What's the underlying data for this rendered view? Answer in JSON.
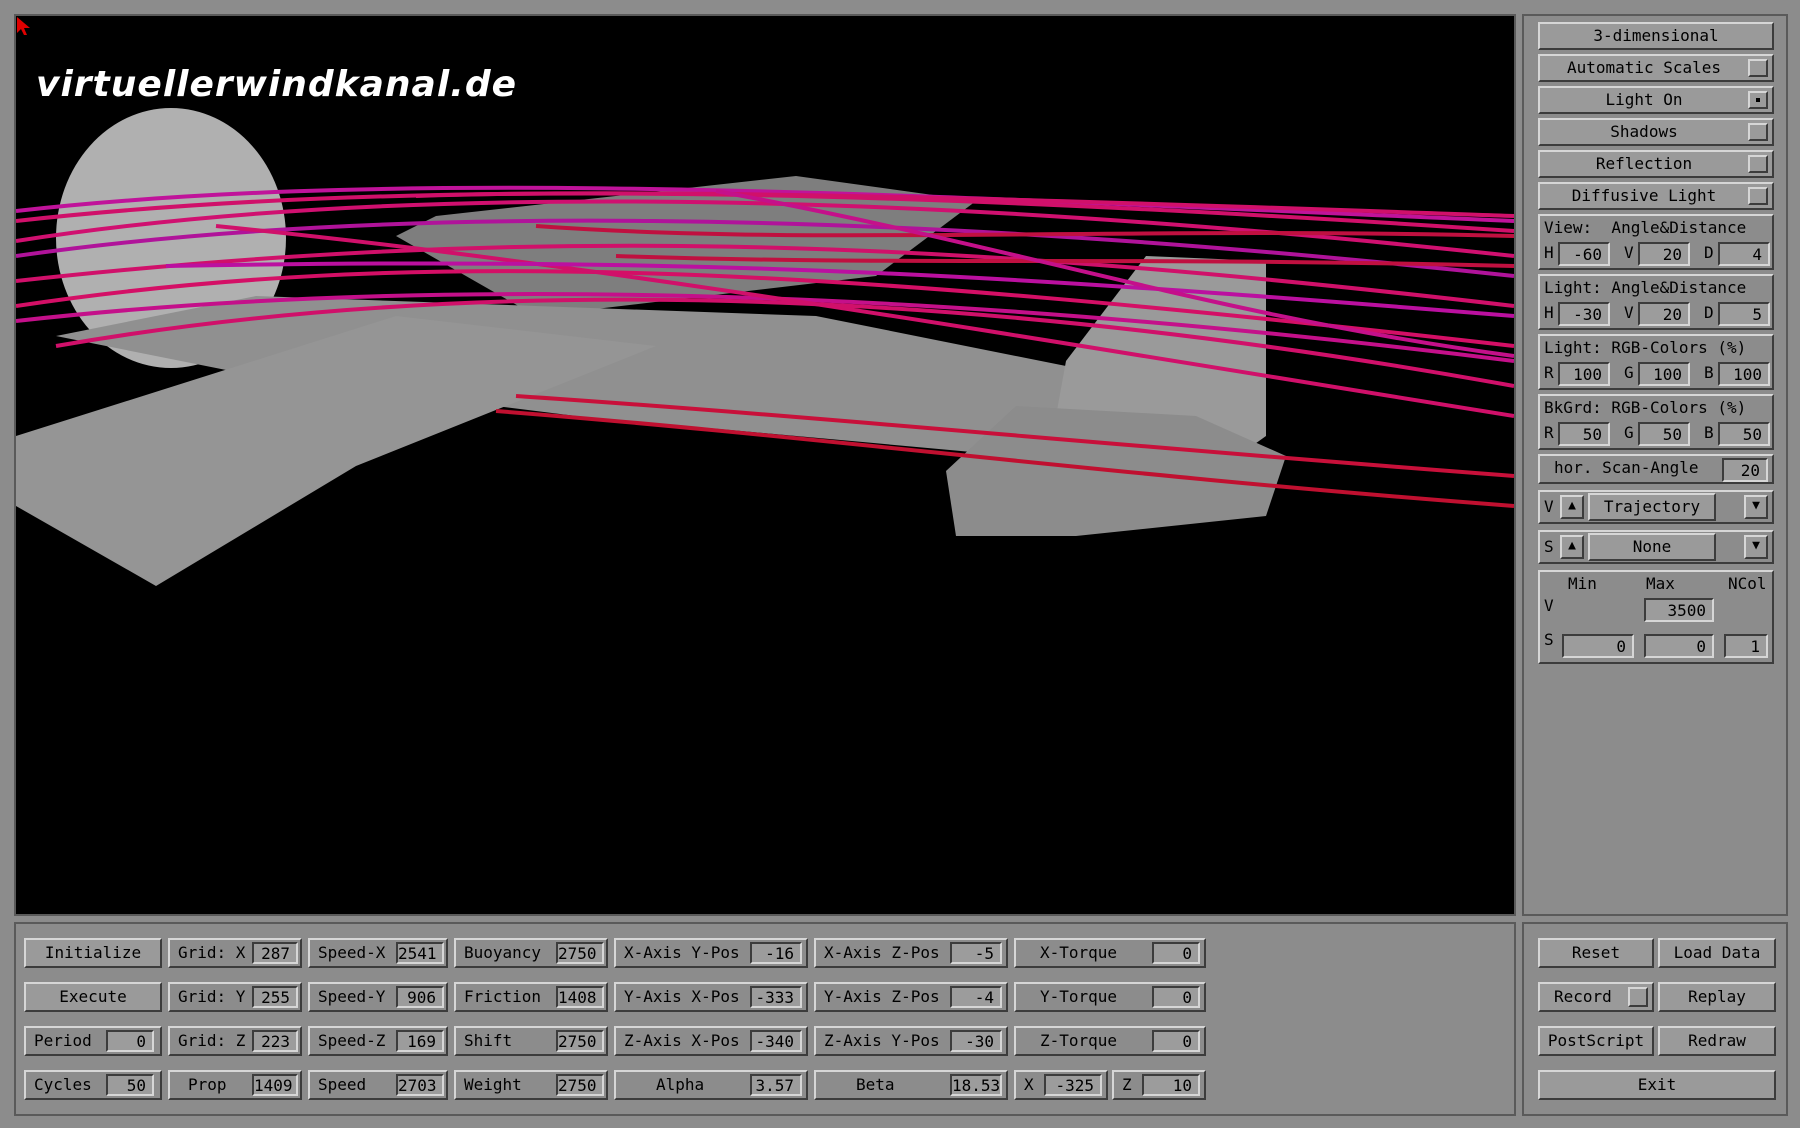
{
  "watermark": "virtuellerwindkanal.de",
  "right": {
    "mode_button": "3-dimensional",
    "toggles": [
      {
        "label": "Automatic Scales",
        "on": false
      },
      {
        "label": "Light On",
        "on": true
      },
      {
        "label": "Shadows",
        "on": false
      },
      {
        "label": "Reflection",
        "on": false
      },
      {
        "label": "Diffusive Light",
        "on": false
      }
    ],
    "view": {
      "title": "View:  Angle&Distance",
      "h_label": "H",
      "h": "-60",
      "v_label": "V",
      "v": "20",
      "d_label": "D",
      "d": "4"
    },
    "light_angle": {
      "title": "Light: Angle&Distance",
      "h_label": "H",
      "h": "-30",
      "v_label": "V",
      "v": "20",
      "d_label": "D",
      "d": "5"
    },
    "light_rgb": {
      "title": "Light: RGB-Colors (%)",
      "r_label": "R",
      "r": "100",
      "g_label": "G",
      "g": "100",
      "b_label": "B",
      "b": "100"
    },
    "bkgrd_rgb": {
      "title": "BkGrd: RGB-Colors (%)",
      "r_label": "R",
      "r": "50",
      "g_label": "G",
      "g": "50",
      "b_label": "B",
      "b": "50"
    },
    "scan": {
      "label": "hor. Scan-Angle",
      "value": "20"
    },
    "v_select": {
      "prefix": "V",
      "value": "Trajectory"
    },
    "s_select": {
      "prefix": "S",
      "value": "None"
    },
    "range": {
      "min_label": "Min",
      "max_label": "Max",
      "ncol_label": "NCol",
      "v_label": "V",
      "v_max": "3500",
      "s_label": "S",
      "s_min": "0",
      "s_max": "0",
      "s_ncol": "1"
    }
  },
  "bottom": {
    "col1": [
      {
        "type": "button",
        "label": "Initialize"
      },
      {
        "type": "button",
        "label": "Execute"
      },
      {
        "type": "field",
        "label": "Period",
        "value": "0"
      },
      {
        "type": "field",
        "label": "Cycles",
        "value": "50"
      }
    ],
    "col2": [
      {
        "label": "Grid: X",
        "value": "287"
      },
      {
        "label": "Grid: Y",
        "value": "255"
      },
      {
        "label": "Grid: Z",
        "value": "223"
      },
      {
        "label": "Prop",
        "value": "1409"
      }
    ],
    "col3": [
      {
        "label": "Speed-X",
        "value": "2541"
      },
      {
        "label": "Speed-Y",
        "value": "906"
      },
      {
        "label": "Speed-Z",
        "value": "169"
      },
      {
        "label": "Speed",
        "value": "2703"
      }
    ],
    "col4": [
      {
        "label": "Buoyancy",
        "value": "2750"
      },
      {
        "label": "Friction",
        "value": "1408"
      },
      {
        "label": "Shift",
        "value": "2750"
      },
      {
        "label": "Weight",
        "value": "2750"
      }
    ],
    "col5": [
      {
        "label": "X-Axis Y-Pos",
        "value": "-16"
      },
      {
        "label": "Y-Axis X-Pos",
        "value": "-333"
      },
      {
        "label": "Z-Axis X-Pos",
        "value": "-340"
      },
      {
        "label": "Alpha",
        "value": "3.57"
      }
    ],
    "col6": [
      {
        "label": "X-Axis Z-Pos",
        "value": "-5"
      },
      {
        "label": "Y-Axis Z-Pos",
        "value": "-4"
      },
      {
        "label": "Z-Axis Y-Pos",
        "value": "-30"
      },
      {
        "label": "Beta",
        "value": "18.53"
      }
    ],
    "col7": [
      {
        "label": "X-Torque",
        "value": "0"
      },
      {
        "label": "Y-Torque",
        "value": "0"
      },
      {
        "label": "Z-Torque",
        "value": "0"
      }
    ],
    "xz": {
      "x_label": "X",
      "x": "-325",
      "z_label": "Z",
      "z": "10"
    }
  },
  "actions": {
    "reset": "Reset",
    "load_data": "Load Data",
    "record": "Record",
    "replay": "Replay",
    "postscript": "PostScript",
    "redraw": "Redraw",
    "exit": "Exit"
  },
  "colors": {
    "panel": "#8c8c8c",
    "viewport_bg": "#000000",
    "streamline": "#d0106a",
    "streamline_alt": "#c01030",
    "model": "#8f8f8f"
  }
}
